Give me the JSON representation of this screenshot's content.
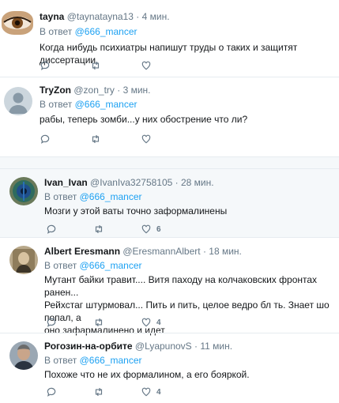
{
  "colors": {
    "link": "#1da1f2",
    "muted": "#657786",
    "text": "#14171a",
    "divider": "#e6ecf0"
  },
  "tweets": [
    {
      "name": "tayna",
      "handle": "@taynatayna13",
      "dot": "·",
      "time": "4 мин.",
      "reply_prefix": "В ответ",
      "mention": "@666_mancer",
      "text_lines": [
        "Когда нибудь психиатры напишут труды о таких и защитят диссертации."
      ],
      "avatar": "eye-avatar",
      "like_count": "",
      "retweet_count": ""
    },
    {
      "name": "TryZon",
      "handle": "@zon_try",
      "dot": "·",
      "time": "3 мин.",
      "reply_prefix": "В ответ",
      "mention": "@666_mancer",
      "text_lines": [
        "рабы, теперь зомби...у них обострение что ли?"
      ],
      "avatar": "default-avatar",
      "like_count": "",
      "retweet_count": ""
    },
    {
      "name": "Ivan_Ivan",
      "handle": "@IvanIva32758105",
      "dot": "·",
      "time": "28 мин.",
      "reply_prefix": "В ответ",
      "mention": "@666_mancer",
      "text_lines": [
        "Мозги у этой ваты точно заформалинены"
      ],
      "avatar": "peacock-avatar",
      "like_count": "6",
      "retweet_count": ""
    },
    {
      "name": "Albert Eresmann",
      "handle": "@EresmannAlbert",
      "dot": "·",
      "time": "18 мин.",
      "reply_prefix": "В ответ",
      "mention": "@666_mancer",
      "text_lines": [
        "Мутант байки травит.... Витя паходу на колчаковских фронтах ранен...",
        "Рейхстаг штурмовал... Пить и пить, целое ведро бл    ть. Знает шо попал, а",
        "оно зафармалинено и идет"
      ],
      "avatar": "portrait-avatar",
      "like_count": "4",
      "retweet_count": ""
    },
    {
      "name": "Рогозин-на-орбите",
      "handle": "@LyapunovS",
      "dot": "·",
      "time": "11 мин.",
      "reply_prefix": "В ответ",
      "mention": "@666_mancer",
      "text_lines": [
        "Похоже что не их формалином, а его бояркой."
      ],
      "avatar": "man-avatar",
      "like_count": "4",
      "retweet_count": ""
    }
  ]
}
